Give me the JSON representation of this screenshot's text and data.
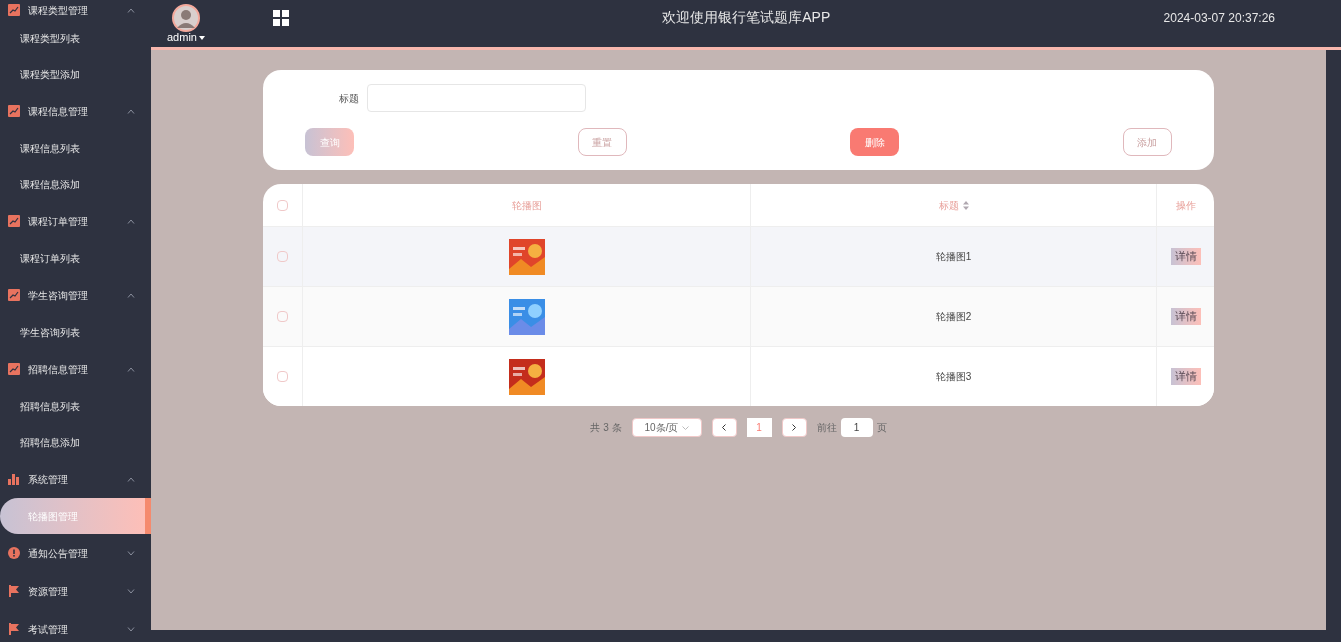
{
  "sidebar": {
    "groups": [
      {
        "label": "课程类型管理",
        "kind": "chart",
        "expanded": true,
        "items": [
          {
            "label": "课程类型列表",
            "selected": false
          },
          {
            "label": "课程类型添加",
            "selected": false
          }
        ]
      },
      {
        "label": "课程信息管理",
        "kind": "chart",
        "expanded": true,
        "items": [
          {
            "label": "课程信息列表",
            "selected": false
          },
          {
            "label": "课程信息添加",
            "selected": false
          }
        ]
      },
      {
        "label": "课程订单管理",
        "kind": "chart",
        "expanded": true,
        "items": [
          {
            "label": "课程订单列表",
            "selected": false
          }
        ]
      },
      {
        "label": "学生咨询管理",
        "kind": "chart",
        "expanded": true,
        "items": [
          {
            "label": "学生咨询列表",
            "selected": false
          }
        ]
      },
      {
        "label": "招聘信息管理",
        "kind": "chart",
        "expanded": true,
        "items": [
          {
            "label": "招聘信息列表",
            "selected": false
          },
          {
            "label": "招聘信息添加",
            "selected": false
          }
        ]
      },
      {
        "label": "系统管理",
        "kind": "bars",
        "expanded": true,
        "items": [
          {
            "label": "轮播图管理",
            "selected": true
          }
        ]
      },
      {
        "label": "通知公告管理",
        "kind": "alert",
        "expanded": false
      },
      {
        "label": "资源管理",
        "kind": "flag",
        "expanded": false
      },
      {
        "label": "考试管理",
        "kind": "flag",
        "expanded": false
      }
    ]
  },
  "header": {
    "user": "admin",
    "title": "欢迎使用银行笔试题库APP",
    "datetime": "2024-03-07 20:37:26"
  },
  "search": {
    "label": "标题",
    "buttons": [
      {
        "label": "查询",
        "kind": "gradient"
      },
      {
        "label": "重置",
        "kind": "outline"
      },
      {
        "label": "删除",
        "kind": "solid"
      },
      {
        "label": "添加",
        "kind": "outline"
      }
    ]
  },
  "table": {
    "all_checked": false,
    "columns": [
      "轮播图",
      "标题",
      "操作"
    ],
    "rows": [
      {
        "checked": false,
        "title": "轮播图1",
        "action": "详情",
        "color": "#e0452a"
      },
      {
        "checked": false,
        "title": "轮播图2",
        "action": "详情",
        "color": "#3a8ee6"
      },
      {
        "checked": false,
        "title": "轮播图3",
        "action": "详情",
        "color": "#c42d1c"
      }
    ]
  },
  "pagination": {
    "total": "共 3 条",
    "page_size": "10条/页",
    "current": "1",
    "goto_label": "前往",
    "goto_value": "1",
    "page_suffix": "页"
  }
}
